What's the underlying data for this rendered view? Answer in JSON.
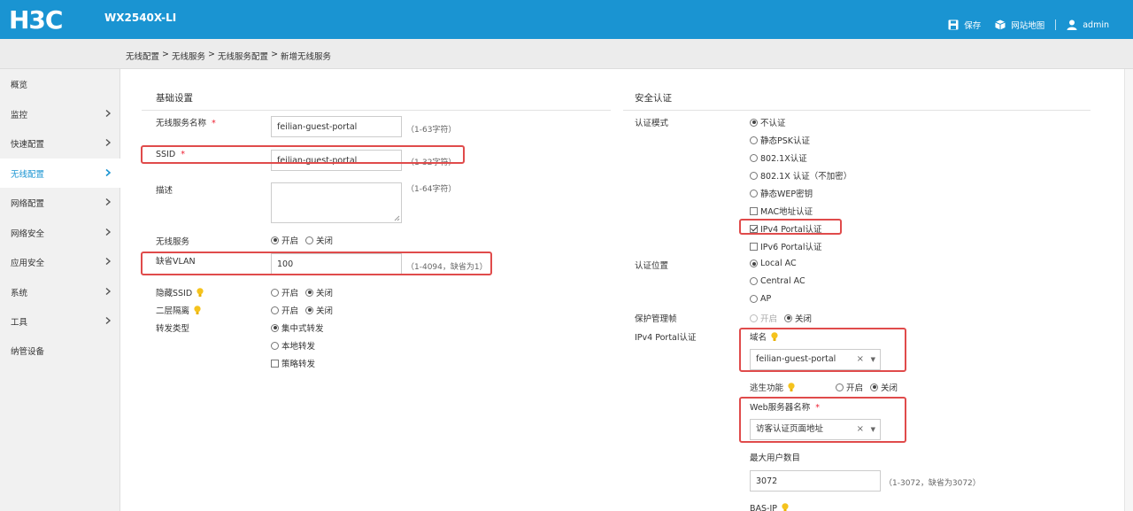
{
  "header": {
    "brand": "H3C",
    "model": "WX2540X-LI",
    "save": "保存",
    "sitemap": "网站地图",
    "user": "admin"
  },
  "breadcrumb": [
    "无线配置",
    "无线服务",
    "无线服务配置",
    "新增无线服务"
  ],
  "sidebar": {
    "items": [
      {
        "label": "概览",
        "chevron": false
      },
      {
        "label": "监控",
        "chevron": true
      },
      {
        "label": "快速配置",
        "chevron": true
      },
      {
        "label": "无线配置",
        "chevron": true,
        "active": true
      },
      {
        "label": "网络配置",
        "chevron": true
      },
      {
        "label": "网络安全",
        "chevron": true
      },
      {
        "label": "应用安全",
        "chevron": true
      },
      {
        "label": "系统",
        "chevron": true
      },
      {
        "label": "工具",
        "chevron": true
      },
      {
        "label": "纳管设备",
        "chevron": false
      }
    ]
  },
  "basic": {
    "title": "基础设置",
    "service_name_label": "无线服务名称",
    "service_name_value": "feilian-guest-portal",
    "service_name_hint": "（1-63字符）",
    "ssid_label": "SSID",
    "ssid_value": "feilian-guest-portal",
    "ssid_hint": "（1-32字符）",
    "desc_label": "描述",
    "desc_hint": "（1-64字符）",
    "wireless_service_label": "无线服务",
    "on": "开启",
    "off": "关闭",
    "vlan_label": "缺省VLAN",
    "vlan_value": "100",
    "vlan_hint": "（1-4094，缺省为1）",
    "hide_ssid_label": "隐藏SSID",
    "l2_isolation_label": "二层隔离",
    "forward_type_label": "转发类型",
    "forward_central": "集中式转发",
    "forward_local": "本地转发",
    "forward_policy": "策略转发",
    "required_mark": "*"
  },
  "security": {
    "title": "安全认证",
    "auth_mode_label": "认证模式",
    "auth_none": "不认证",
    "auth_psk": "静态PSK认证",
    "auth_8021x": "802.1X认证",
    "auth_8021x_noenc": "802.1X 认证（不加密）",
    "auth_wep": "静态WEP密钥",
    "auth_mac": "MAC地址认证",
    "auth_ipv4_portal": "IPv4 Portal认证",
    "auth_ipv6_portal": "IPv6 Portal认证",
    "auth_location_label": "认证位置",
    "loc_local": "Local AC",
    "loc_central": "Central AC",
    "loc_ap": "AP",
    "mgmt_frame_label": "保护管理帧",
    "on": "开启",
    "off": "关闭",
    "portal_label": "IPv4 Portal认证",
    "domain_label": "域名",
    "domain_value": "feilian-guest-portal",
    "escape_label": "逃生功能",
    "web_server_label": "Web服务器名称",
    "web_server_value": "访客认证页面地址",
    "max_users_label": "最大用户数目",
    "max_users_value": "3072",
    "max_users_hint": "（1-3072，缺省为3072）",
    "bas_ip_label": "BAS-IP",
    "required_mark": "*",
    "clear_glyph": "×",
    "caret_glyph": "▼"
  },
  "colors": {
    "header_bg": "#1a94d2",
    "active_menu": "#1a94d2",
    "highlight_box": "#e04b4b",
    "required": "#e23"
  }
}
